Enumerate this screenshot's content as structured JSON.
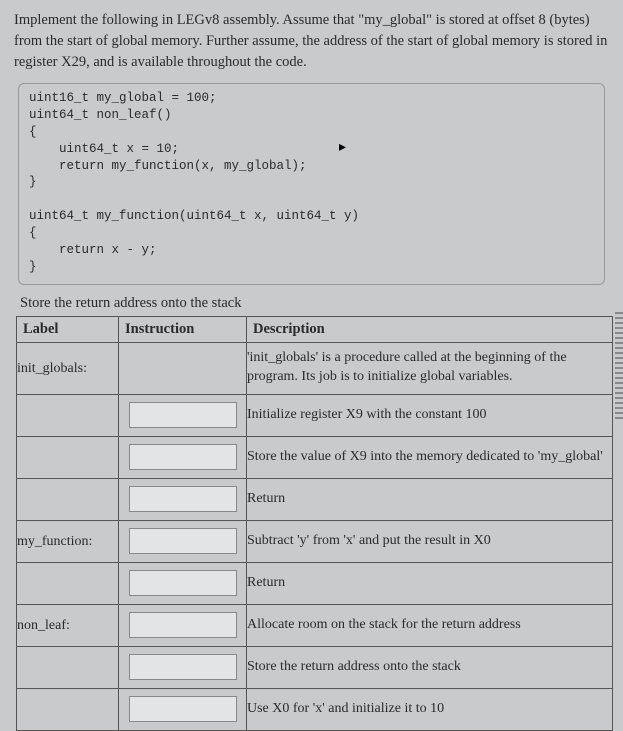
{
  "prompt": "Implement the following in LEGv8 assembly. Assume that \"my_global\" is stored at offset 8 (bytes) from the start of global memory. Further assume, the address of the start of global memory is stored in register X29, and is available throughout the code.",
  "code": "uint16_t my_global = 100;\nuint64_t non_leaf()\n{\n    uint64_t x = 10;\n    return my_function(x, my_global);\n}\n\nuint64_t my_function(uint64_t x, uint64_t y)\n{\n    return x - y;\n}",
  "subheading": "Store the return address onto the stack",
  "headers": {
    "label": "Label",
    "instruction": "Instruction",
    "description": "Description"
  },
  "rows": [
    {
      "label": "init_globals:",
      "desc": "'init_globals' is a procedure called at the beginning of the program.  Its job is to initialize global variables."
    },
    {
      "label": "",
      "desc": "Initialize register X9 with the constant 100"
    },
    {
      "label": "",
      "desc": "Store the value of X9 into the memory dedicated to 'my_global'"
    },
    {
      "label": "",
      "desc": "Return"
    },
    {
      "label": "my_function:",
      "desc": "Subtract 'y' from 'x' and put the result in X0"
    },
    {
      "label": "",
      "desc": "Return"
    },
    {
      "label": "non_leaf:",
      "desc": "Allocate room on the stack for the return address"
    },
    {
      "label": "",
      "desc": "Store the return address onto the stack"
    },
    {
      "label": "",
      "desc": "Use X0 for 'x' and initialize it to 10"
    }
  ]
}
